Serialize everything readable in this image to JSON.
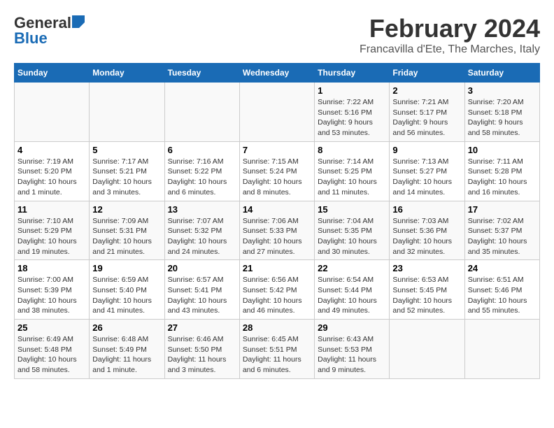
{
  "logo": {
    "line1": "General",
    "line2": "Blue"
  },
  "title": "February 2024",
  "subtitle": "Francavilla d'Ete, The Marches, Italy",
  "days_of_week": [
    "Sunday",
    "Monday",
    "Tuesday",
    "Wednesday",
    "Thursday",
    "Friday",
    "Saturday"
  ],
  "weeks": [
    [
      {
        "day": "",
        "info": ""
      },
      {
        "day": "",
        "info": ""
      },
      {
        "day": "",
        "info": ""
      },
      {
        "day": "",
        "info": ""
      },
      {
        "day": "1",
        "info": "Sunrise: 7:22 AM\nSunset: 5:16 PM\nDaylight: 9 hours\nand 53 minutes."
      },
      {
        "day": "2",
        "info": "Sunrise: 7:21 AM\nSunset: 5:17 PM\nDaylight: 9 hours\nand 56 minutes."
      },
      {
        "day": "3",
        "info": "Sunrise: 7:20 AM\nSunset: 5:18 PM\nDaylight: 9 hours\nand 58 minutes."
      }
    ],
    [
      {
        "day": "4",
        "info": "Sunrise: 7:19 AM\nSunset: 5:20 PM\nDaylight: 10 hours\nand 1 minute."
      },
      {
        "day": "5",
        "info": "Sunrise: 7:17 AM\nSunset: 5:21 PM\nDaylight: 10 hours\nand 3 minutes."
      },
      {
        "day": "6",
        "info": "Sunrise: 7:16 AM\nSunset: 5:22 PM\nDaylight: 10 hours\nand 6 minutes."
      },
      {
        "day": "7",
        "info": "Sunrise: 7:15 AM\nSunset: 5:24 PM\nDaylight: 10 hours\nand 8 minutes."
      },
      {
        "day": "8",
        "info": "Sunrise: 7:14 AM\nSunset: 5:25 PM\nDaylight: 10 hours\nand 11 minutes."
      },
      {
        "day": "9",
        "info": "Sunrise: 7:13 AM\nSunset: 5:27 PM\nDaylight: 10 hours\nand 14 minutes."
      },
      {
        "day": "10",
        "info": "Sunrise: 7:11 AM\nSunset: 5:28 PM\nDaylight: 10 hours\nand 16 minutes."
      }
    ],
    [
      {
        "day": "11",
        "info": "Sunrise: 7:10 AM\nSunset: 5:29 PM\nDaylight: 10 hours\nand 19 minutes."
      },
      {
        "day": "12",
        "info": "Sunrise: 7:09 AM\nSunset: 5:31 PM\nDaylight: 10 hours\nand 21 minutes."
      },
      {
        "day": "13",
        "info": "Sunrise: 7:07 AM\nSunset: 5:32 PM\nDaylight: 10 hours\nand 24 minutes."
      },
      {
        "day": "14",
        "info": "Sunrise: 7:06 AM\nSunset: 5:33 PM\nDaylight: 10 hours\nand 27 minutes."
      },
      {
        "day": "15",
        "info": "Sunrise: 7:04 AM\nSunset: 5:35 PM\nDaylight: 10 hours\nand 30 minutes."
      },
      {
        "day": "16",
        "info": "Sunrise: 7:03 AM\nSunset: 5:36 PM\nDaylight: 10 hours\nand 32 minutes."
      },
      {
        "day": "17",
        "info": "Sunrise: 7:02 AM\nSunset: 5:37 PM\nDaylight: 10 hours\nand 35 minutes."
      }
    ],
    [
      {
        "day": "18",
        "info": "Sunrise: 7:00 AM\nSunset: 5:39 PM\nDaylight: 10 hours\nand 38 minutes."
      },
      {
        "day": "19",
        "info": "Sunrise: 6:59 AM\nSunset: 5:40 PM\nDaylight: 10 hours\nand 41 minutes."
      },
      {
        "day": "20",
        "info": "Sunrise: 6:57 AM\nSunset: 5:41 PM\nDaylight: 10 hours\nand 43 minutes."
      },
      {
        "day": "21",
        "info": "Sunrise: 6:56 AM\nSunset: 5:42 PM\nDaylight: 10 hours\nand 46 minutes."
      },
      {
        "day": "22",
        "info": "Sunrise: 6:54 AM\nSunset: 5:44 PM\nDaylight: 10 hours\nand 49 minutes."
      },
      {
        "day": "23",
        "info": "Sunrise: 6:53 AM\nSunset: 5:45 PM\nDaylight: 10 hours\nand 52 minutes."
      },
      {
        "day": "24",
        "info": "Sunrise: 6:51 AM\nSunset: 5:46 PM\nDaylight: 10 hours\nand 55 minutes."
      }
    ],
    [
      {
        "day": "25",
        "info": "Sunrise: 6:49 AM\nSunset: 5:48 PM\nDaylight: 10 hours\nand 58 minutes."
      },
      {
        "day": "26",
        "info": "Sunrise: 6:48 AM\nSunset: 5:49 PM\nDaylight: 11 hours\nand 1 minute."
      },
      {
        "day": "27",
        "info": "Sunrise: 6:46 AM\nSunset: 5:50 PM\nDaylight: 11 hours\nand 3 minutes."
      },
      {
        "day": "28",
        "info": "Sunrise: 6:45 AM\nSunset: 5:51 PM\nDaylight: 11 hours\nand 6 minutes."
      },
      {
        "day": "29",
        "info": "Sunrise: 6:43 AM\nSunset: 5:53 PM\nDaylight: 11 hours\nand 9 minutes."
      },
      {
        "day": "",
        "info": ""
      },
      {
        "day": "",
        "info": ""
      }
    ]
  ]
}
